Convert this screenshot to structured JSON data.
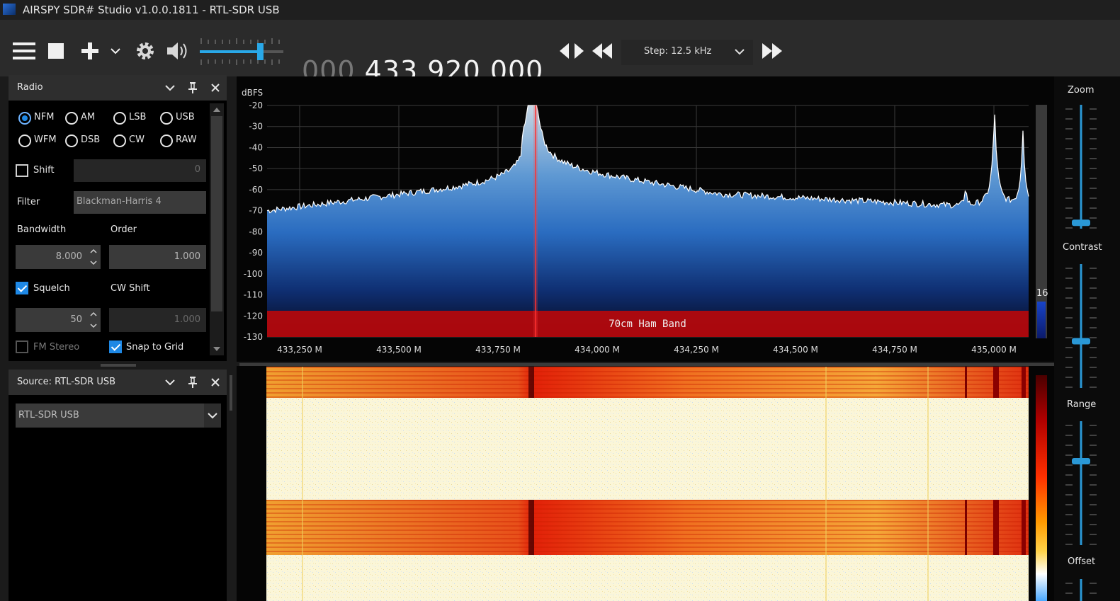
{
  "window": {
    "title": "AIRSPY SDR# Studio v1.0.0.1811 - RTL-SDR USB"
  },
  "toolbar": {
    "freq_prefix": "000",
    "freq_main": ".433.920.000",
    "step_label": "Step: 12.5 kHz",
    "volume_level": 0.72
  },
  "radio_panel": {
    "title": "Radio",
    "modes": [
      "NFM",
      "AM",
      "LSB",
      "USB",
      "WFM",
      "DSB",
      "CW",
      "RAW"
    ],
    "selected_mode": "NFM",
    "shift_label": "Shift",
    "shift_value": "0",
    "filter_label": "Filter",
    "filter_value": "Blackman-Harris 4",
    "bandwidth_label": "Bandwidth",
    "bandwidth_value": "8.000",
    "order_label": "Order",
    "order_value": "1.000",
    "squelch_label": "Squelch",
    "squelch_value": "50",
    "cwshift_label": "CW Shift",
    "cwshift_value": "1.000",
    "fmstereo_label": "FM Stereo",
    "snap_label": "Snap to Grid"
  },
  "source_panel": {
    "title": "Source: RTL-SDR USB",
    "device": "RTL-SDR USB"
  },
  "spectrum": {
    "unit_label": "dBFS",
    "y_ticks": [
      "-20",
      "-30",
      "-40",
      "-50",
      "-60",
      "-70",
      "-80",
      "-90",
      "-100",
      "-110",
      "-120",
      "-130"
    ],
    "x_ticks": [
      "433,250 M",
      "433,500 M",
      "433,750 M",
      "434,000 M",
      "434,250 M",
      "434,500 M",
      "434,750 M",
      "435,000 M"
    ],
    "band_label": "70cm Ham Band",
    "side_value": "16"
  },
  "right_panel": {
    "zoom_label": "Zoom",
    "contrast_label": "Contrast",
    "range_label": "Range",
    "offset_label": "Offset"
  }
}
